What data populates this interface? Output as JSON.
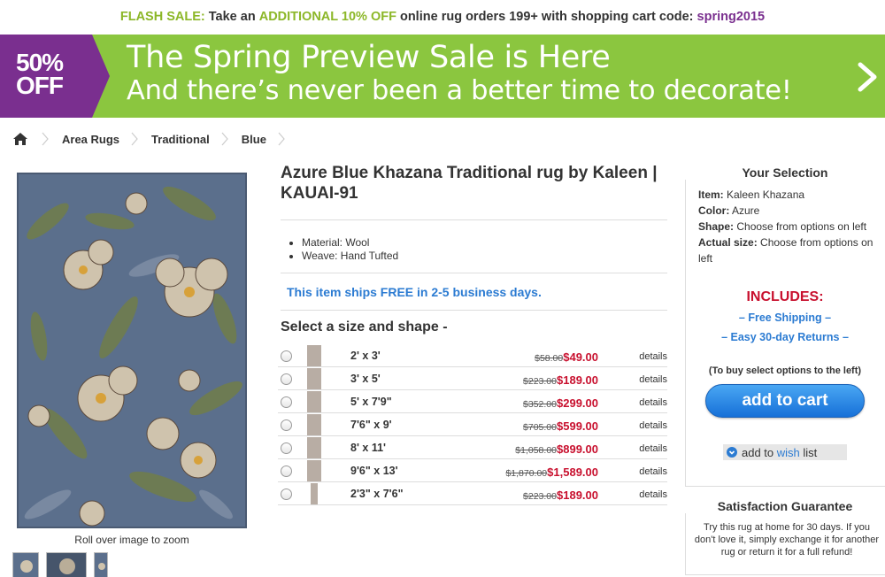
{
  "flash_bar": {
    "prefix": "FLASH SALE:",
    "text1": " Take an ",
    "highlight": "ADDITIONAL 10% OFF",
    "text2": " online rug orders 199+ with shopping cart code: ",
    "code": "spring2015"
  },
  "banner": {
    "badge_line1": "50%",
    "badge_line2": "OFF",
    "line1": "The Spring Preview Sale is Here",
    "line2": "And there’s never been a better time to decorate!",
    "arrow_icon": "chevron-right-icon",
    "color": "#8bc63f",
    "badge_color": "#7a2f8f"
  },
  "breadcrumb": {
    "home_icon": "home-icon",
    "items": [
      "Area Rugs",
      "Traditional",
      "Blue"
    ]
  },
  "gallery": {
    "caption": "Roll over image to zoom"
  },
  "product": {
    "title": "Azure Blue Khazana Traditional rug by Kaleen | KAUAI-91",
    "features": [
      "Material: Wool",
      "Weave: Hand Tufted"
    ],
    "shipping": "This item ships FREE in 2-5 business days.",
    "select_heading": "Select a size and shape -",
    "sizes": [
      {
        "dims": "2' x 3'",
        "old": "$58.00",
        "new": "$49.00",
        "details": "details"
      },
      {
        "dims": "3' x 5'",
        "old": "$223.00",
        "new": "$189.00",
        "details": "details"
      },
      {
        "dims": "5' x 7'9\"",
        "old": "$352.00",
        "new": "$299.00",
        "details": "details"
      },
      {
        "dims": "7'6\" x 9'",
        "old": "$705.00",
        "new": "$599.00",
        "details": "details"
      },
      {
        "dims": "8' x 11'",
        "old": "$1,058.00",
        "new": "$899.00",
        "details": "details"
      },
      {
        "dims": "9'6\" x 13'",
        "old": "$1,870.00",
        "new": "$1,589.00",
        "details": "details"
      },
      {
        "dims": "2'3\" x 7'6\"",
        "old": "$223.00",
        "new": "$189.00",
        "details": "details"
      }
    ]
  },
  "selection": {
    "title": "Your Selection",
    "item_label": "Item:",
    "item_value": " Kaleen Khazana",
    "color_label": "Color:",
    "color_value": " Azure",
    "shape_label": "Shape:",
    "shape_value": " Choose from options on left",
    "size_label": "Actual size:",
    "size_value": " Choose from options on left",
    "includes": "INCLUDES:",
    "include_items": [
      "– Free Shipping –",
      "– Easy 30-day Returns –"
    ],
    "buy_note": "(To buy select options to the left)",
    "cart_button": "add to cart",
    "wish_prefix": "add to ",
    "wish_highlight": "wish",
    "wish_suffix": " list"
  },
  "guarantee": {
    "title": "Satisfaction Guarantee",
    "text": "Try this rug at home for 30 days. If you don't love it, simply exchange it for another rug or return it for a full refund!"
  }
}
